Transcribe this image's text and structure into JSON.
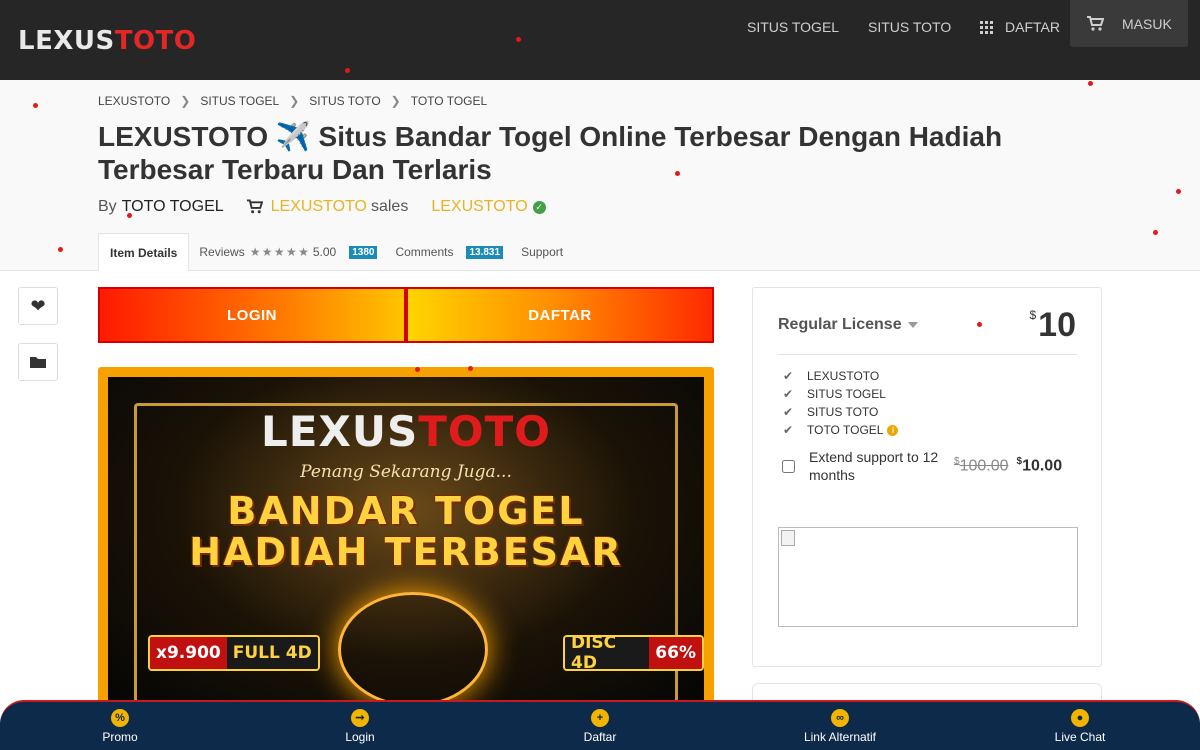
{
  "brand": {
    "part1": "LEXUS",
    "part2": "TOTO"
  },
  "nav": {
    "situs_togel": "SITUS TOGEL",
    "situs_toto": "SITUS TOTO",
    "daftar": "DAFTAR",
    "masuk": "MASUK"
  },
  "breadcrumb": [
    "LEXUSTOTO",
    "SITUS TOGEL",
    "SITUS TOTO",
    "TOTO TOGEL"
  ],
  "page_title": "LEXUSTOTO ✈️ Situs Bandar Togel Online Terbesar Dengan Hadiah Terbesar Terbaru Dan Terlaris",
  "byline": {
    "by": "By",
    "author": "TOTO TOGEL",
    "seller": "LEXUSTOTO",
    "sales_word": "sales",
    "store": "LEXUSTOTO"
  },
  "tabs": {
    "item_details": "Item Details",
    "reviews": "Reviews",
    "rating": "5.00",
    "review_count": "1380",
    "comments": "Comments",
    "comment_count": "13.831",
    "support": "Support"
  },
  "cta": {
    "login": "LOGIN",
    "daftar": "DAFTAR"
  },
  "banner": {
    "logo_part1": "LEXUS",
    "logo_part2": "TOTO",
    "script": "Penang Sekarang Juga...",
    "line1": "BANDAR TOGEL",
    "line2": "HADIAH TERBESAR",
    "tag_left_a": "x9.900",
    "tag_left_b": "FULL 4D",
    "tag_right_a": "DISC 4D",
    "tag_right_b": "66%"
  },
  "license": {
    "title": "Regular License",
    "currency": "$",
    "price": "10",
    "features": [
      "LEXUSTOTO",
      "SITUS TOGEL",
      "SITUS TOTO",
      "TOTO TOGEL"
    ],
    "extend_label": "Extend support to 12 months",
    "old_price": "100.00",
    "new_price": "10.00"
  },
  "bottom_nav": {
    "promo": "Promo",
    "login": "Login",
    "daftar": "Daftar",
    "link_alternatif": "Link Alternatif",
    "live_chat": "Live Chat"
  },
  "colors": {
    "topbar": "#262626",
    "brand_red": "#e32626",
    "gold": "#e6b422",
    "bottom_bar": "#0d2a4a"
  }
}
